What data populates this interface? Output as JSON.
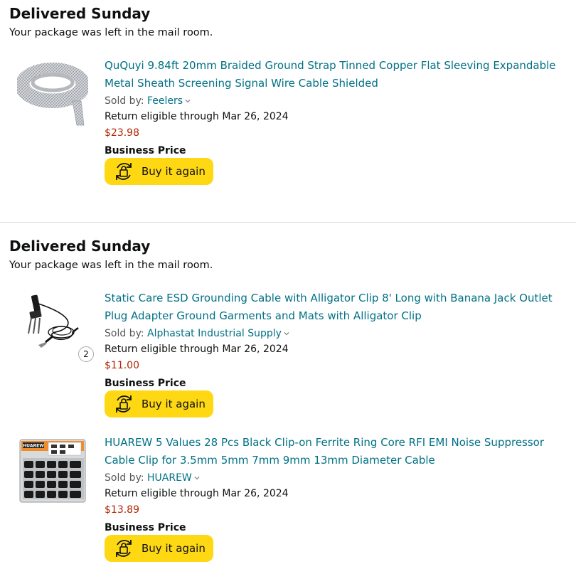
{
  "orders": [
    {
      "status_title": "Delivered Sunday",
      "status_sub": "Your package was left in the mail room.",
      "items": [
        {
          "title": "QuQuyi 9.84ft 20mm Braided Ground Strap Tinned Copper Flat Sleeving Expandable Metal Sheath Screening Signal Wire Cable Shielded",
          "sold_by_label": "Sold by: ",
          "seller": "Feelers",
          "return_text": "Return eligible through Mar 26, 2024",
          "price": "$23.98",
          "business_price": "Business Price",
          "button_label": "Buy it again",
          "image_icon": "braided-strap-image"
        }
      ]
    },
    {
      "status_title": "Delivered Sunday",
      "status_sub": "Your package was left in the mail room.",
      "items": [
        {
          "title": "Static Care ESD Grounding Cable with Alligator Clip 8' Long with Banana Jack Outlet Plug Adapter Ground Garments and Mats with Alligator Clip",
          "sold_by_label": "Sold by: ",
          "seller": "Alphastat Industrial Supply",
          "return_text": "Return eligible through Mar 26, 2024",
          "price": "$11.00",
          "business_price": "Business Price",
          "button_label": "Buy it again",
          "quantity": "2",
          "image_icon": "grounding-cable-image"
        },
        {
          "title": "HUAREW 5 Values 28 Pcs Black Clip-on Ferrite Ring Core RFI EMI Noise Suppressor Cable Clip for 3.5mm 5mm 7mm 9mm 13mm Diameter Cable",
          "sold_by_label": "Sold by: ",
          "seller": "HUAREW",
          "return_text": "Return eligible through Mar 26, 2024",
          "price": "$13.89",
          "business_price": "Business Price",
          "button_label": "Buy it again",
          "image_icon": "ferrite-core-box-image",
          "brand_label": "HUAREW"
        }
      ]
    }
  ],
  "colors": {
    "link": "#007185",
    "price": "#b12704",
    "button": "#ffd814",
    "divider": "#dddddd"
  }
}
